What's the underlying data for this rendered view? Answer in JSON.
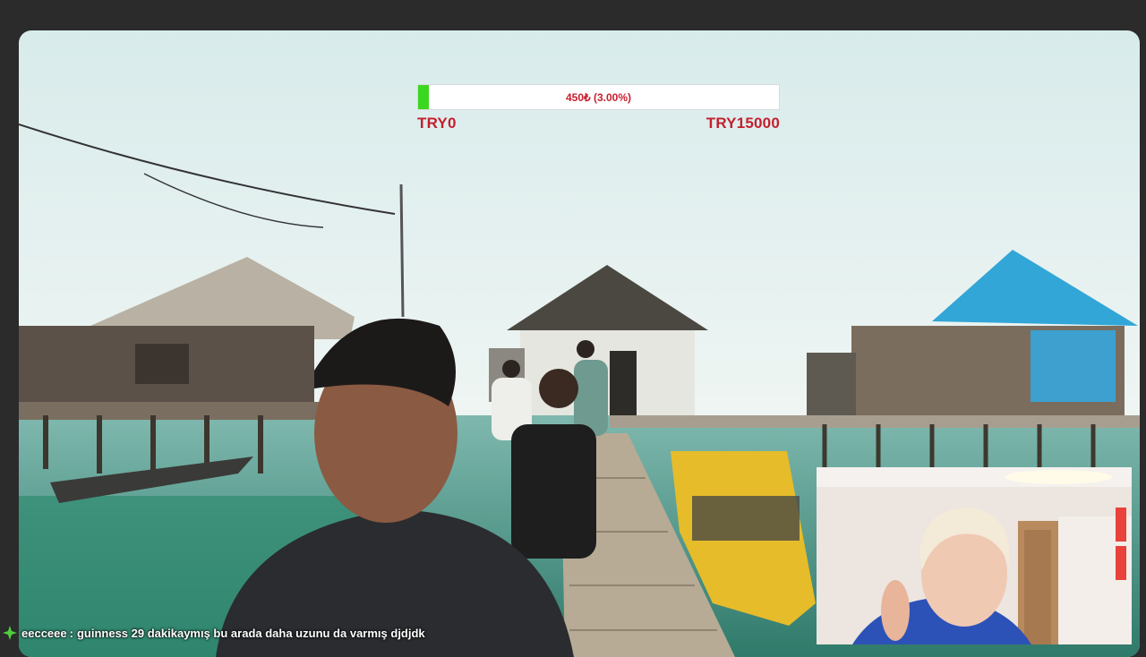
{
  "goal": {
    "progress_fraction": 0.03,
    "progress_label": "450₺ (3.00%)",
    "min_label": "TRY0",
    "max_label": "TRY15000",
    "fill_color": "#3cd81f",
    "text_color": "#c51f2d"
  },
  "chat": {
    "icon": "green-plus-sparkle-icon",
    "username": "eecceee",
    "separator": ":",
    "message": "guinness 29 dakikaymış bu arada daha uzunu da varmış djdjdk"
  }
}
